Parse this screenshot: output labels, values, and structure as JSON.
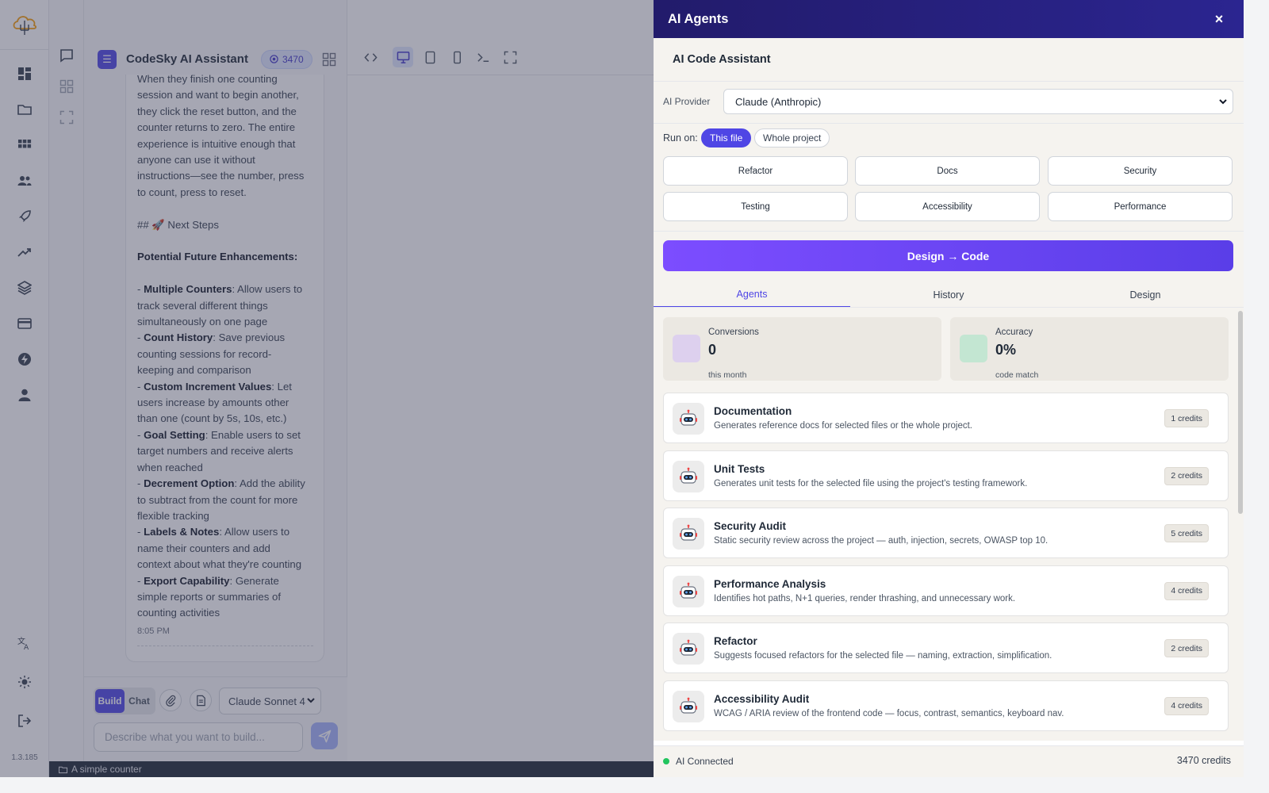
{
  "rail": {
    "version": "1.3.185",
    "icons": [
      "dashboard-icon",
      "folder-icon",
      "apps-grid-icon",
      "team-icon",
      "rocket-icon",
      "trending-icon",
      "layers-icon",
      "billing-card-icon",
      "bolt-icon",
      "profile-icon",
      "translate-icon",
      "theme-sun-icon",
      "logout-icon"
    ]
  },
  "chat": {
    "app_title": "CodeSky AI Assistant",
    "credits": "3470",
    "message": {
      "intro_lines": [
        "When they finish one counting",
        "session and want to begin another,",
        "they click the reset button, and the",
        "counter returns to zero. The entire",
        "experience is intuitive enough that",
        "anyone can use it without",
        "instructions—see the number, press",
        "to count, press to reset."
      ],
      "heading": "## 🚀 Next Steps",
      "subheading": "Potential Future Enhancements:",
      "items": [
        {
          "title": "Multiple Counters",
          "lines": [
            ": Allow users to",
            "track several different things",
            "simultaneously on one page"
          ]
        },
        {
          "title": "Count History",
          "lines": [
            ": Save previous",
            "counting sessions for record-",
            "keeping and comparison"
          ]
        },
        {
          "title": "Custom Increment Values",
          "lines": [
            ": Let",
            "users increase by amounts other",
            "than one (count by 5s, 10s, etc.)"
          ]
        },
        {
          "title": "Goal Setting",
          "lines": [
            ": Enable users to set",
            "target numbers and receive alerts",
            "when reached"
          ]
        },
        {
          "title": "Decrement Option",
          "lines": [
            ": Add the ability",
            "to subtract from the count for more",
            "flexible tracking"
          ]
        },
        {
          "title": "Labels & Notes",
          "lines": [
            ": Allow users to",
            "name their counters and add",
            "context about what they're counting"
          ]
        },
        {
          "title": "Export Capability",
          "lines": [
            ": Generate",
            "simple reports or summaries of",
            "counting activities"
          ]
        }
      ],
      "time": "8:05 PM"
    },
    "composer": {
      "build_label": "Build",
      "chat_label": "Chat",
      "model": "Claude Sonnet 4",
      "placeholder": "Describe what you want to build..."
    }
  },
  "status_bar": {
    "project": "A simple counter"
  },
  "drawer": {
    "title": "AI Agents",
    "close_label": "×",
    "section_title": "AI Code Assistant",
    "provider_label": "AI Provider",
    "provider_value": "Claude (Anthropic)",
    "run_on_label": "Run on:",
    "run_on_options": [
      "This file",
      "Whole project"
    ],
    "actions": [
      "Refactor",
      "Docs",
      "Security",
      "Testing",
      "Accessibility",
      "Performance"
    ],
    "design_to_code": "Design → Code",
    "tabs": [
      "Agents",
      "History",
      "Design"
    ],
    "stats": [
      {
        "label": "Conversions",
        "value": "0",
        "sub": "this month",
        "color": "#ddd0ee"
      },
      {
        "label": "Accuracy",
        "value": "0%",
        "sub": "code match",
        "color": "#c3e6d2"
      }
    ],
    "agents": [
      {
        "name": "Documentation",
        "desc": "Generates reference docs for selected files or the whole project.",
        "credits": "1 credits"
      },
      {
        "name": "Unit Tests",
        "desc": "Generates unit tests for the selected file using the project's testing framework.",
        "credits": "2 credits"
      },
      {
        "name": "Security Audit",
        "desc": "Static security review across the project — auth, injection, secrets, OWASP top 10.",
        "credits": "5 credits"
      },
      {
        "name": "Performance Analysis",
        "desc": "Identifies hot paths, N+1 queries, render thrashing, and unnecessary work.",
        "credits": "4 credits"
      },
      {
        "name": "Refactor",
        "desc": "Suggests focused refactors for the selected file — naming, extraction, simplification.",
        "credits": "2 credits"
      },
      {
        "name": "Accessibility Audit",
        "desc": "WCAG / ARIA review of the frontend code — focus, contrast, semantics, keyboard nav.",
        "credits": "4 credits"
      }
    ],
    "footer": {
      "status": "AI Connected",
      "credits": "3470 credits"
    }
  },
  "colors": {
    "accent": "#4f46e5",
    "drawer_header": "#2b2590",
    "connected": "#22c55e"
  }
}
